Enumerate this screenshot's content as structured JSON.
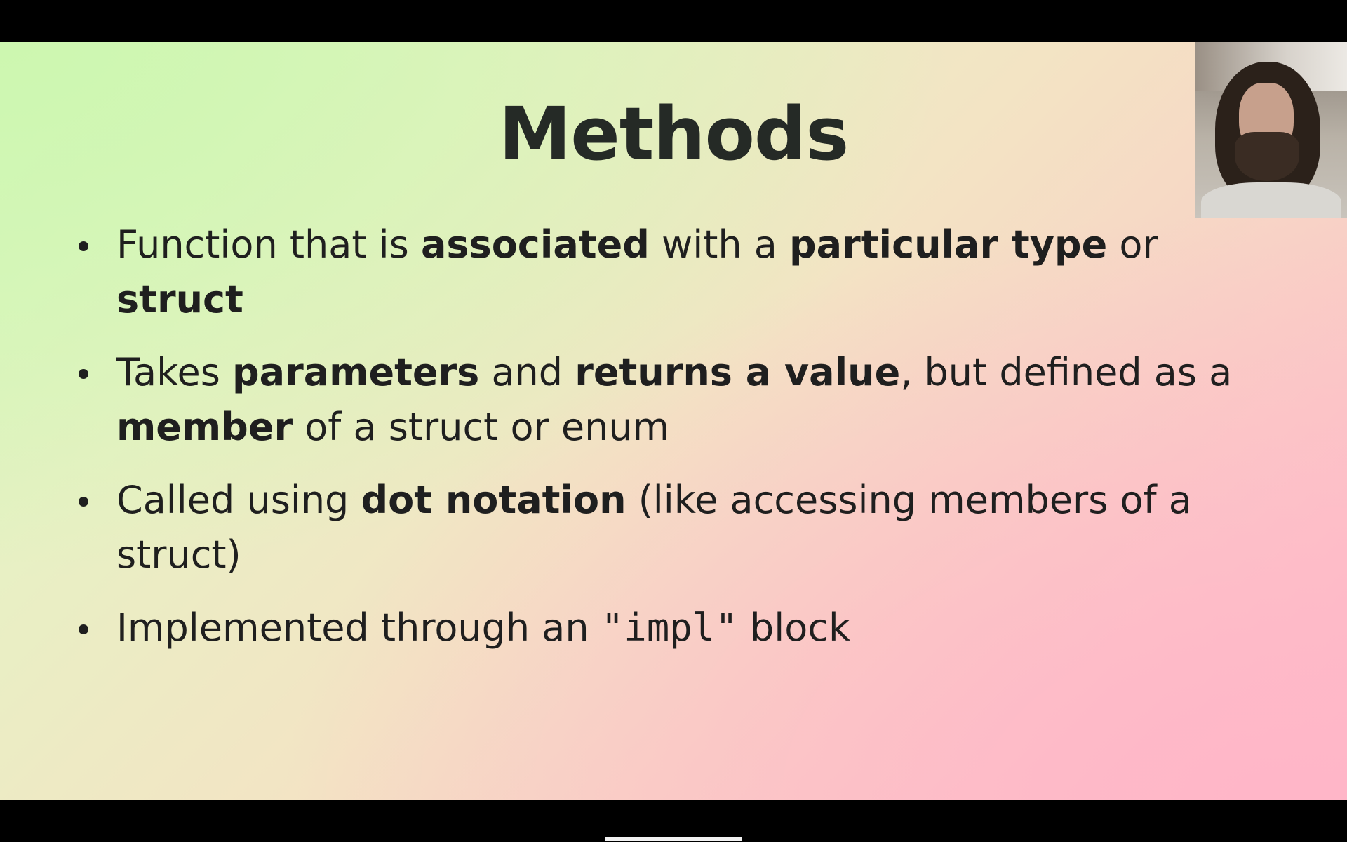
{
  "slide": {
    "title": "Methods",
    "bullets": [
      {
        "segments": [
          {
            "text": "Function that is ",
            "bold": false
          },
          {
            "text": "associated",
            "bold": true
          },
          {
            "text": " with a ",
            "bold": false
          },
          {
            "text": "particular type",
            "bold": true
          },
          {
            "text": " or ",
            "bold": false
          },
          {
            "text": "struct",
            "bold": true
          }
        ]
      },
      {
        "segments": [
          {
            "text": "Takes ",
            "bold": false
          },
          {
            "text": "parameters",
            "bold": true
          },
          {
            "text": " and ",
            "bold": false
          },
          {
            "text": "returns a value",
            "bold": true
          },
          {
            "text": ", but defined as a ",
            "bold": false
          },
          {
            "text": "member",
            "bold": true
          },
          {
            "text": " of a struct or enum",
            "bold": false
          }
        ]
      },
      {
        "segments": [
          {
            "text": "Called using ",
            "bold": false
          },
          {
            "text": "dot notation",
            "bold": true
          },
          {
            "text": " (like accessing members of a struct)",
            "bold": false
          }
        ]
      },
      {
        "segments": [
          {
            "text": "Implemented through an ",
            "bold": false
          },
          {
            "text": "\"impl\"",
            "code": true
          },
          {
            "text": " block",
            "bold": false
          }
        ]
      }
    ]
  },
  "webcam": {
    "icon": "presenter-video-feed"
  },
  "colors": {
    "title": "#252a26",
    "text": "#1f1f1f",
    "gradient_green": "#d6f8bf",
    "gradient_pink": "#ffbcc9"
  }
}
